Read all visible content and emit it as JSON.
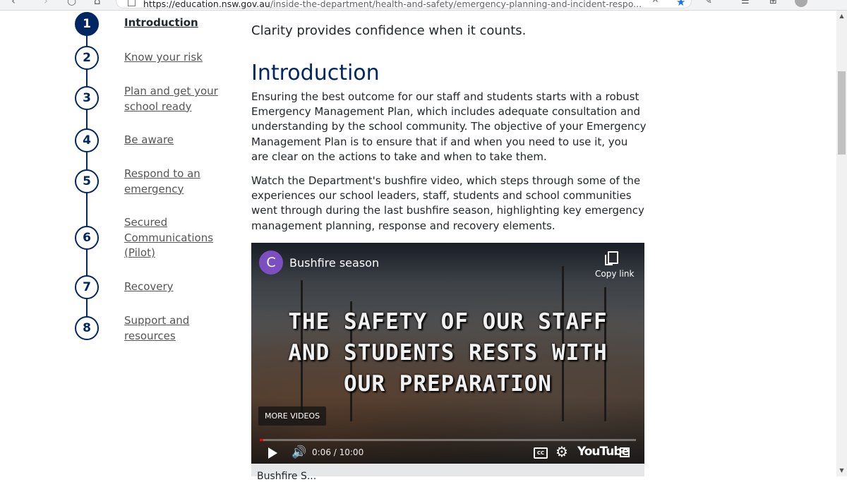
{
  "browser": {
    "url_domain": "https://education.nsw.gov.au",
    "url_path": "/inside-the-department/health-and-safety/emergency-planning-and-incident-respo...",
    "icons": [
      "back-icon",
      "forward-icon",
      "reload-icon",
      "home-icon",
      "page-info-icon",
      "star-icon",
      "extension-icon",
      "reading-list-icon",
      "collections-icon",
      "profile-icon"
    ]
  },
  "steps": [
    {
      "num": "1",
      "label": "Introduction",
      "active": true
    },
    {
      "num": "2",
      "label": "Know your risk"
    },
    {
      "num": "3",
      "label": "Plan and get your school ready"
    },
    {
      "num": "4",
      "label": "Be aware"
    },
    {
      "num": "5",
      "label": "Respond to an emergency"
    },
    {
      "num": "6",
      "label": "Secured Communications (Pilot)"
    },
    {
      "num": "7",
      "label": "Recovery"
    },
    {
      "num": "8",
      "label": "Support and resources"
    }
  ],
  "main": {
    "lede": "Clarity provides confidence when it counts.",
    "heading": "Introduction",
    "paragraphs": [
      "Ensuring the best outcome for our staff and students starts with a robust Emergency Management Plan, which includes adequate consultation and understanding by the school community. The objective of your Emergency Management Plan is to ensure that if and when you need to use it, you are clear on the actions to take and when to take them.",
      "Watch the Department's bushfire video, which steps through some of the experiences our school leaders, staff, students and school communities went through during the last bushfire season, highlighting key emergency management planning, response and recovery elements."
    ]
  },
  "video": {
    "channel_initial": "C",
    "title": "Bushfire season",
    "copy_link": "Copy link",
    "overlay_lines": [
      "THE SAFETY OF OUR STAFF",
      "AND STUDENTS RESTS WITH",
      "OUR PREPARATION"
    ],
    "more_videos": "MORE VIDEOS",
    "time": "0:06 / 10:00",
    "progress": 0.01,
    "youtube": "YouTube",
    "cc": "CC",
    "caption_below": "Bushfire S..."
  },
  "colors": {
    "accent": "#002664",
    "text": "#22272b",
    "link": "#555555"
  }
}
